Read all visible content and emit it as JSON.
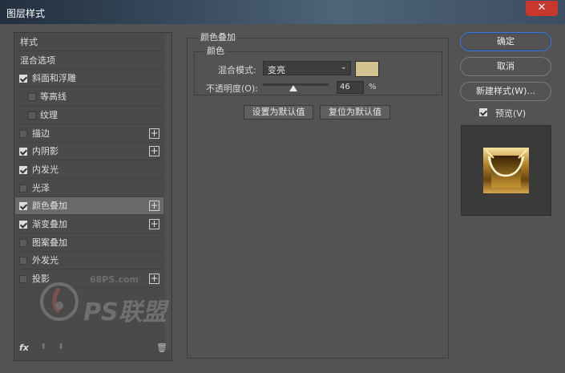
{
  "window": {
    "title": "图层样式",
    "close_glyph": "✕"
  },
  "style_list": {
    "items": [
      {
        "label": "样式",
        "checkbox": false,
        "checked": false,
        "plus": false,
        "active": false,
        "indent": false
      },
      {
        "label": "混合选项",
        "checkbox": false,
        "checked": false,
        "plus": false,
        "active": false,
        "indent": false
      },
      {
        "label": "斜面和浮雕",
        "checkbox": true,
        "checked": true,
        "plus": false,
        "active": false,
        "indent": false
      },
      {
        "label": "等高线",
        "checkbox": true,
        "checked": false,
        "plus": false,
        "active": false,
        "indent": true
      },
      {
        "label": "纹理",
        "checkbox": true,
        "checked": false,
        "plus": false,
        "active": false,
        "indent": true
      },
      {
        "label": "描边",
        "checkbox": true,
        "checked": false,
        "plus": true,
        "active": false,
        "indent": false
      },
      {
        "label": "内阴影",
        "checkbox": true,
        "checked": true,
        "plus": true,
        "active": false,
        "indent": false
      },
      {
        "label": "内发光",
        "checkbox": true,
        "checked": true,
        "plus": false,
        "active": false,
        "indent": false
      },
      {
        "label": "光泽",
        "checkbox": true,
        "checked": false,
        "plus": false,
        "active": false,
        "indent": false
      },
      {
        "label": "颜色叠加",
        "checkbox": true,
        "checked": true,
        "plus": true,
        "active": true,
        "indent": false
      },
      {
        "label": "渐变叠加",
        "checkbox": true,
        "checked": true,
        "plus": true,
        "active": false,
        "indent": false
      },
      {
        "label": "图案叠加",
        "checkbox": true,
        "checked": false,
        "plus": false,
        "active": false,
        "indent": false
      },
      {
        "label": "外发光",
        "checkbox": true,
        "checked": false,
        "plus": false,
        "active": false,
        "indent": false
      },
      {
        "label": "投影",
        "checkbox": true,
        "checked": false,
        "plus": true,
        "active": false,
        "indent": false
      }
    ],
    "fx_label": "fx",
    "plus_glyph": "+",
    "up_glyph": "⬆",
    "down_glyph": "⬇",
    "trash_glyph": "🗑"
  },
  "color_overlay": {
    "group_title": "颜色叠加",
    "subgroup_title": "颜色",
    "blend_label": "混合模式:",
    "blend_value": "变亮",
    "chevron": "⌄",
    "overlay_color": "#d1c290",
    "opacity_label": "不透明度(O):",
    "opacity_value": "46",
    "opacity_fraction": 0.46,
    "pct": "%",
    "set_default": "设置为默认值",
    "reset_default": "复位为默认值"
  },
  "actions": {
    "ok": "确定",
    "cancel": "取消",
    "new_style": "新建样式(W)...",
    "preview_label": "预览(V)",
    "preview_checked": true
  },
  "watermark": {
    "site": "68PS.com",
    "brand": "PS联盟"
  }
}
